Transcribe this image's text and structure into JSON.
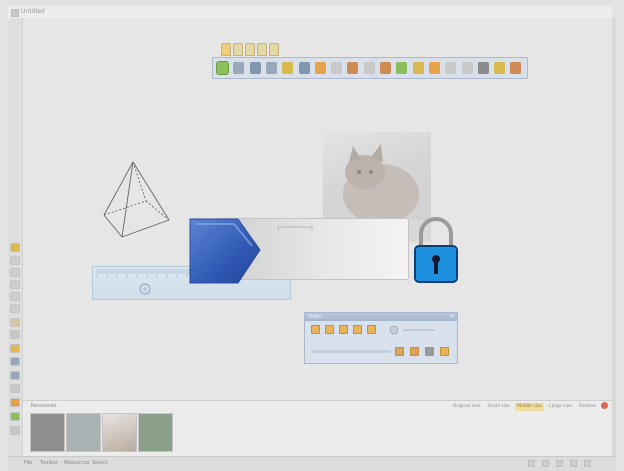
{
  "window": {
    "title": "Untitled"
  },
  "toolbar": {
    "tabs": [
      "main",
      "tab-2",
      "tab-3",
      "tab-4",
      "tab-5"
    ],
    "tools": [
      {
        "icon": "select-arrow-icon",
        "color": "#8cbf5a"
      },
      {
        "icon": "scissors-icon",
        "color": "#9aa7b8"
      },
      {
        "icon": "pencil-icon",
        "color": "#7f95b0"
      },
      {
        "icon": "pen-icon",
        "color": "#9aa7b8"
      },
      {
        "icon": "highlighter-icon",
        "color": "#d9b94e"
      },
      {
        "icon": "ruler-pen-icon",
        "color": "#7f95b0"
      },
      {
        "icon": "magic-wand-icon",
        "color": "#e6a34a"
      },
      {
        "icon": "pointer-icon",
        "color": "#c9c9c9"
      },
      {
        "icon": "undo-icon",
        "color": "#d08a55"
      },
      {
        "icon": "redo-icon",
        "color": "#c9c9c9"
      },
      {
        "icon": "text-icon",
        "color": "#d08a55"
      },
      {
        "icon": "pin-icon",
        "color": "#8cbf5a"
      },
      {
        "icon": "shapes-icon",
        "color": "#d9b94e"
      },
      {
        "icon": "paint-bucket-icon",
        "color": "#e6a34a"
      },
      {
        "icon": "eraser-icon",
        "color": "#c9c9c9"
      },
      {
        "icon": "screen-icon",
        "color": "#c9c9c9"
      },
      {
        "icon": "camera-icon",
        "color": "#8a8a8a"
      },
      {
        "icon": "folder-icon",
        "color": "#d9b94e"
      },
      {
        "icon": "settings-icon",
        "color": "#d08a55"
      }
    ]
  },
  "left_tools": [
    {
      "icon": "page-icon",
      "color": "#e2b74c"
    },
    {
      "icon": "grid-icon",
      "color": "#cfcfcf"
    },
    {
      "icon": "hand-icon",
      "color": "#cfcfcf"
    },
    {
      "icon": "calendar-icon",
      "color": "#cfcfcf"
    },
    {
      "icon": "blank-icon",
      "color": "#cfcfcf"
    },
    {
      "icon": "blank-icon",
      "color": "#cfcfcf"
    },
    {
      "icon": "person-icon",
      "color": "#d6c9a0"
    },
    {
      "icon": "info-icon",
      "color": "#c9c9c9"
    },
    {
      "icon": "text-icon",
      "color": "#e2b74c"
    },
    {
      "icon": "search-icon",
      "color": "#9aa7b8"
    },
    {
      "icon": "zoom-icon",
      "color": "#9aa7b8"
    },
    {
      "icon": "hand-icon",
      "color": "#c9c9c9"
    },
    {
      "icon": "puzzle-icon",
      "color": "#e6a34a"
    },
    {
      "icon": "add-icon",
      "color": "#8cbf5a"
    },
    {
      "icon": "shape-icon",
      "color": "#c9c9c9"
    }
  ],
  "player": {
    "title": "Video",
    "buttons": [
      "play-icon",
      "pause-icon",
      "stop-icon",
      "rewind-icon",
      "forward-icon"
    ],
    "bottom_icons": [
      "person-icon",
      "download-icon",
      "film-icon",
      "fullscreen-icon"
    ]
  },
  "strip": {
    "label": "Resources",
    "tabs": [
      {
        "label": "Original size",
        "active": false
      },
      {
        "label": "Small size",
        "active": false
      },
      {
        "label": "Middle size",
        "active": true
      },
      {
        "label": "Large size",
        "active": false
      },
      {
        "label": "Restore",
        "active": false
      }
    ],
    "thumbs": [
      {
        "name": "thumb-dark-grey",
        "color": "#8f8f8f"
      },
      {
        "name": "thumb-grey-blue",
        "color": "#a9b3b3"
      },
      {
        "name": "thumb-kitten",
        "color": "#c9bcae"
      },
      {
        "name": "thumb-green",
        "color": "#8aa08a"
      }
    ]
  },
  "statusbar": {
    "items": [
      "File",
      "Toolbar",
      "Resources",
      "Select"
    ],
    "right_icons": [
      "grid-icon",
      "monitor-icon",
      "camera-icon",
      "pen-icon",
      "settings-icon"
    ]
  }
}
